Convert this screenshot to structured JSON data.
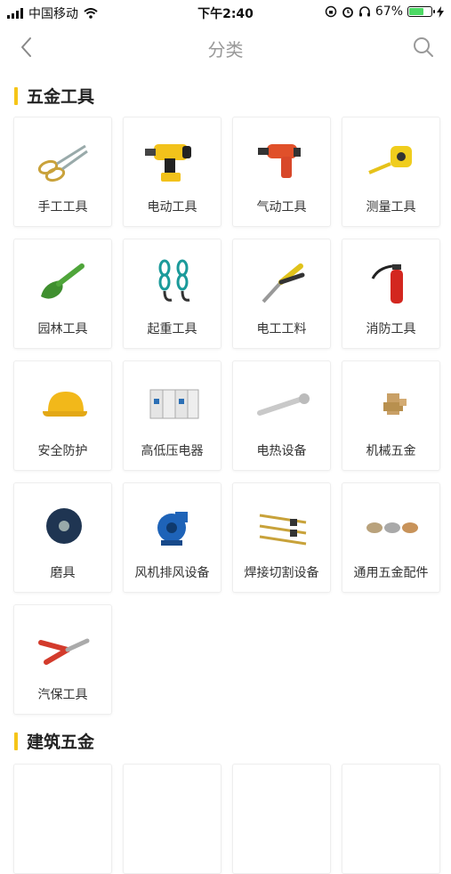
{
  "status_bar": {
    "carrier": "中国移动",
    "time": "下午2:40",
    "battery": "67%"
  },
  "nav": {
    "title": "分类"
  },
  "sections": [
    {
      "title": "五金工具",
      "items": [
        {
          "label": "手工工具",
          "icon": "scissors-icon"
        },
        {
          "label": "电动工具",
          "icon": "drill-icon"
        },
        {
          "label": "气动工具",
          "icon": "air-wrench-icon"
        },
        {
          "label": "测量工具",
          "icon": "tape-measure-icon"
        },
        {
          "label": "园林工具",
          "icon": "trowel-icon"
        },
        {
          "label": "起重工具",
          "icon": "lifting-hook-icon"
        },
        {
          "label": "电工工料",
          "icon": "pliers-icon"
        },
        {
          "label": "消防工具",
          "icon": "fire-extinguisher-icon"
        },
        {
          "label": "安全防护",
          "icon": "hard-hat-icon"
        },
        {
          "label": "高低压电器",
          "icon": "circuit-breaker-icon"
        },
        {
          "label": "电热设备",
          "icon": "heating-rod-icon"
        },
        {
          "label": "机械五金",
          "icon": "brass-fitting-icon"
        },
        {
          "label": "磨具",
          "icon": "grinding-disc-icon"
        },
        {
          "label": "风机排风设备",
          "icon": "blower-fan-icon"
        },
        {
          "label": "焊接切割设备",
          "icon": "welding-torch-icon"
        },
        {
          "label": "通用五金配件",
          "icon": "metal-caps-icon"
        },
        {
          "label": "汽保工具",
          "icon": "crimping-pliers-icon"
        }
      ]
    },
    {
      "title": "建筑五金",
      "items": []
    }
  ]
}
